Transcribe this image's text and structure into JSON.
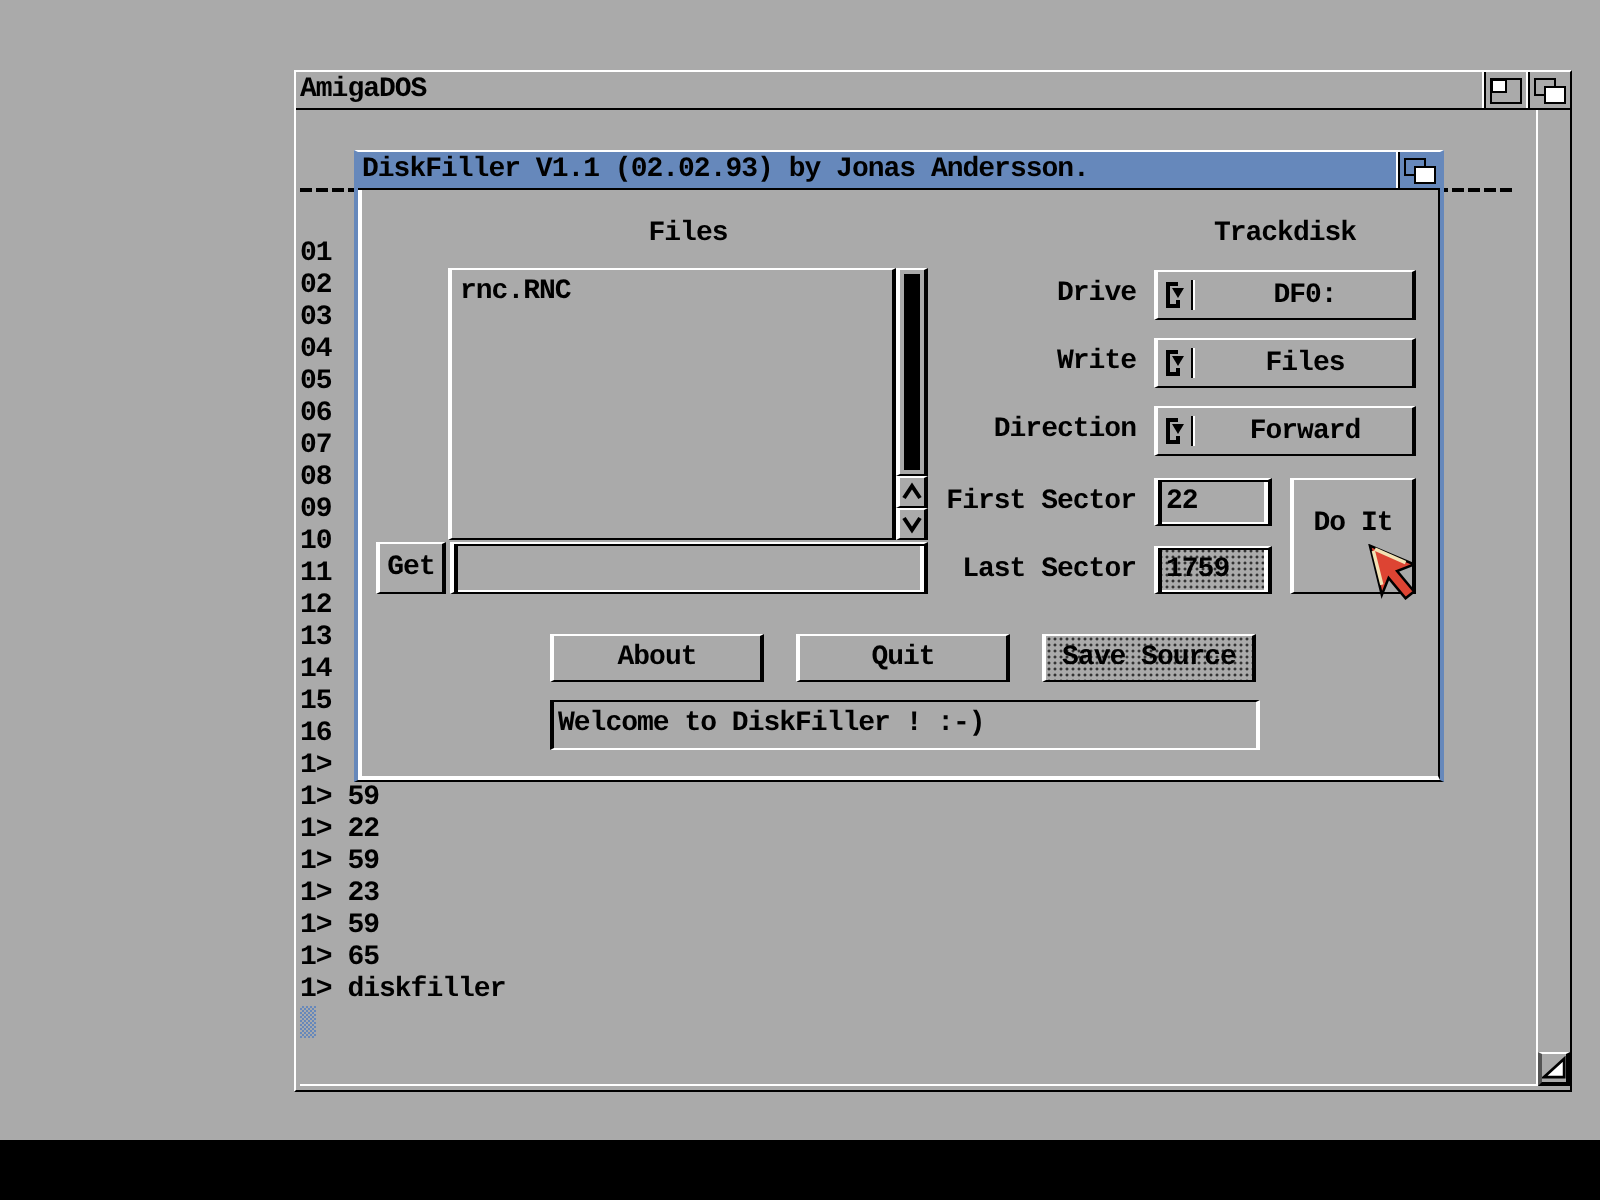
{
  "console_window": {
    "title": "AmigaDOS",
    "active": false,
    "lines": [
      "01",
      "02",
      "03",
      "04",
      "05",
      "06",
      "07",
      "08",
      "09",
      "10",
      "11",
      "12",
      "13",
      "14",
      "15",
      "16",
      "1>",
      "1> 59",
      "1> 22",
      "1> 59",
      "1> 23",
      "1> 59",
      "1> 65",
      "1> diskfiller"
    ]
  },
  "app_window": {
    "title": "DiskFiller V1.1 (02.02.93) by Jonas Andersson.",
    "active": true,
    "files": {
      "heading": "Files",
      "items": [
        {
          "label": "rnc.RNC",
          "selected": false
        }
      ],
      "get_button": "Get"
    },
    "trackdisk": {
      "heading": "Trackdisk",
      "cycles": [
        {
          "label": "Drive",
          "value": "DF0:"
        },
        {
          "label": "Write",
          "value": "Files"
        },
        {
          "label": "Direction",
          "value": "Forward"
        }
      ],
      "sectors": [
        {
          "label": "First Sector",
          "value": "22",
          "disabled": false
        },
        {
          "label": "Last Sector",
          "value": "1759",
          "disabled": true
        }
      ],
      "do_it_button": "Do It"
    },
    "buttons": [
      {
        "label": "About",
        "disabled": false
      },
      {
        "label": "Quit",
        "disabled": false
      },
      {
        "label": "Save Source",
        "disabled": true
      }
    ],
    "status": "Welcome to DiskFiller ! :-)"
  }
}
